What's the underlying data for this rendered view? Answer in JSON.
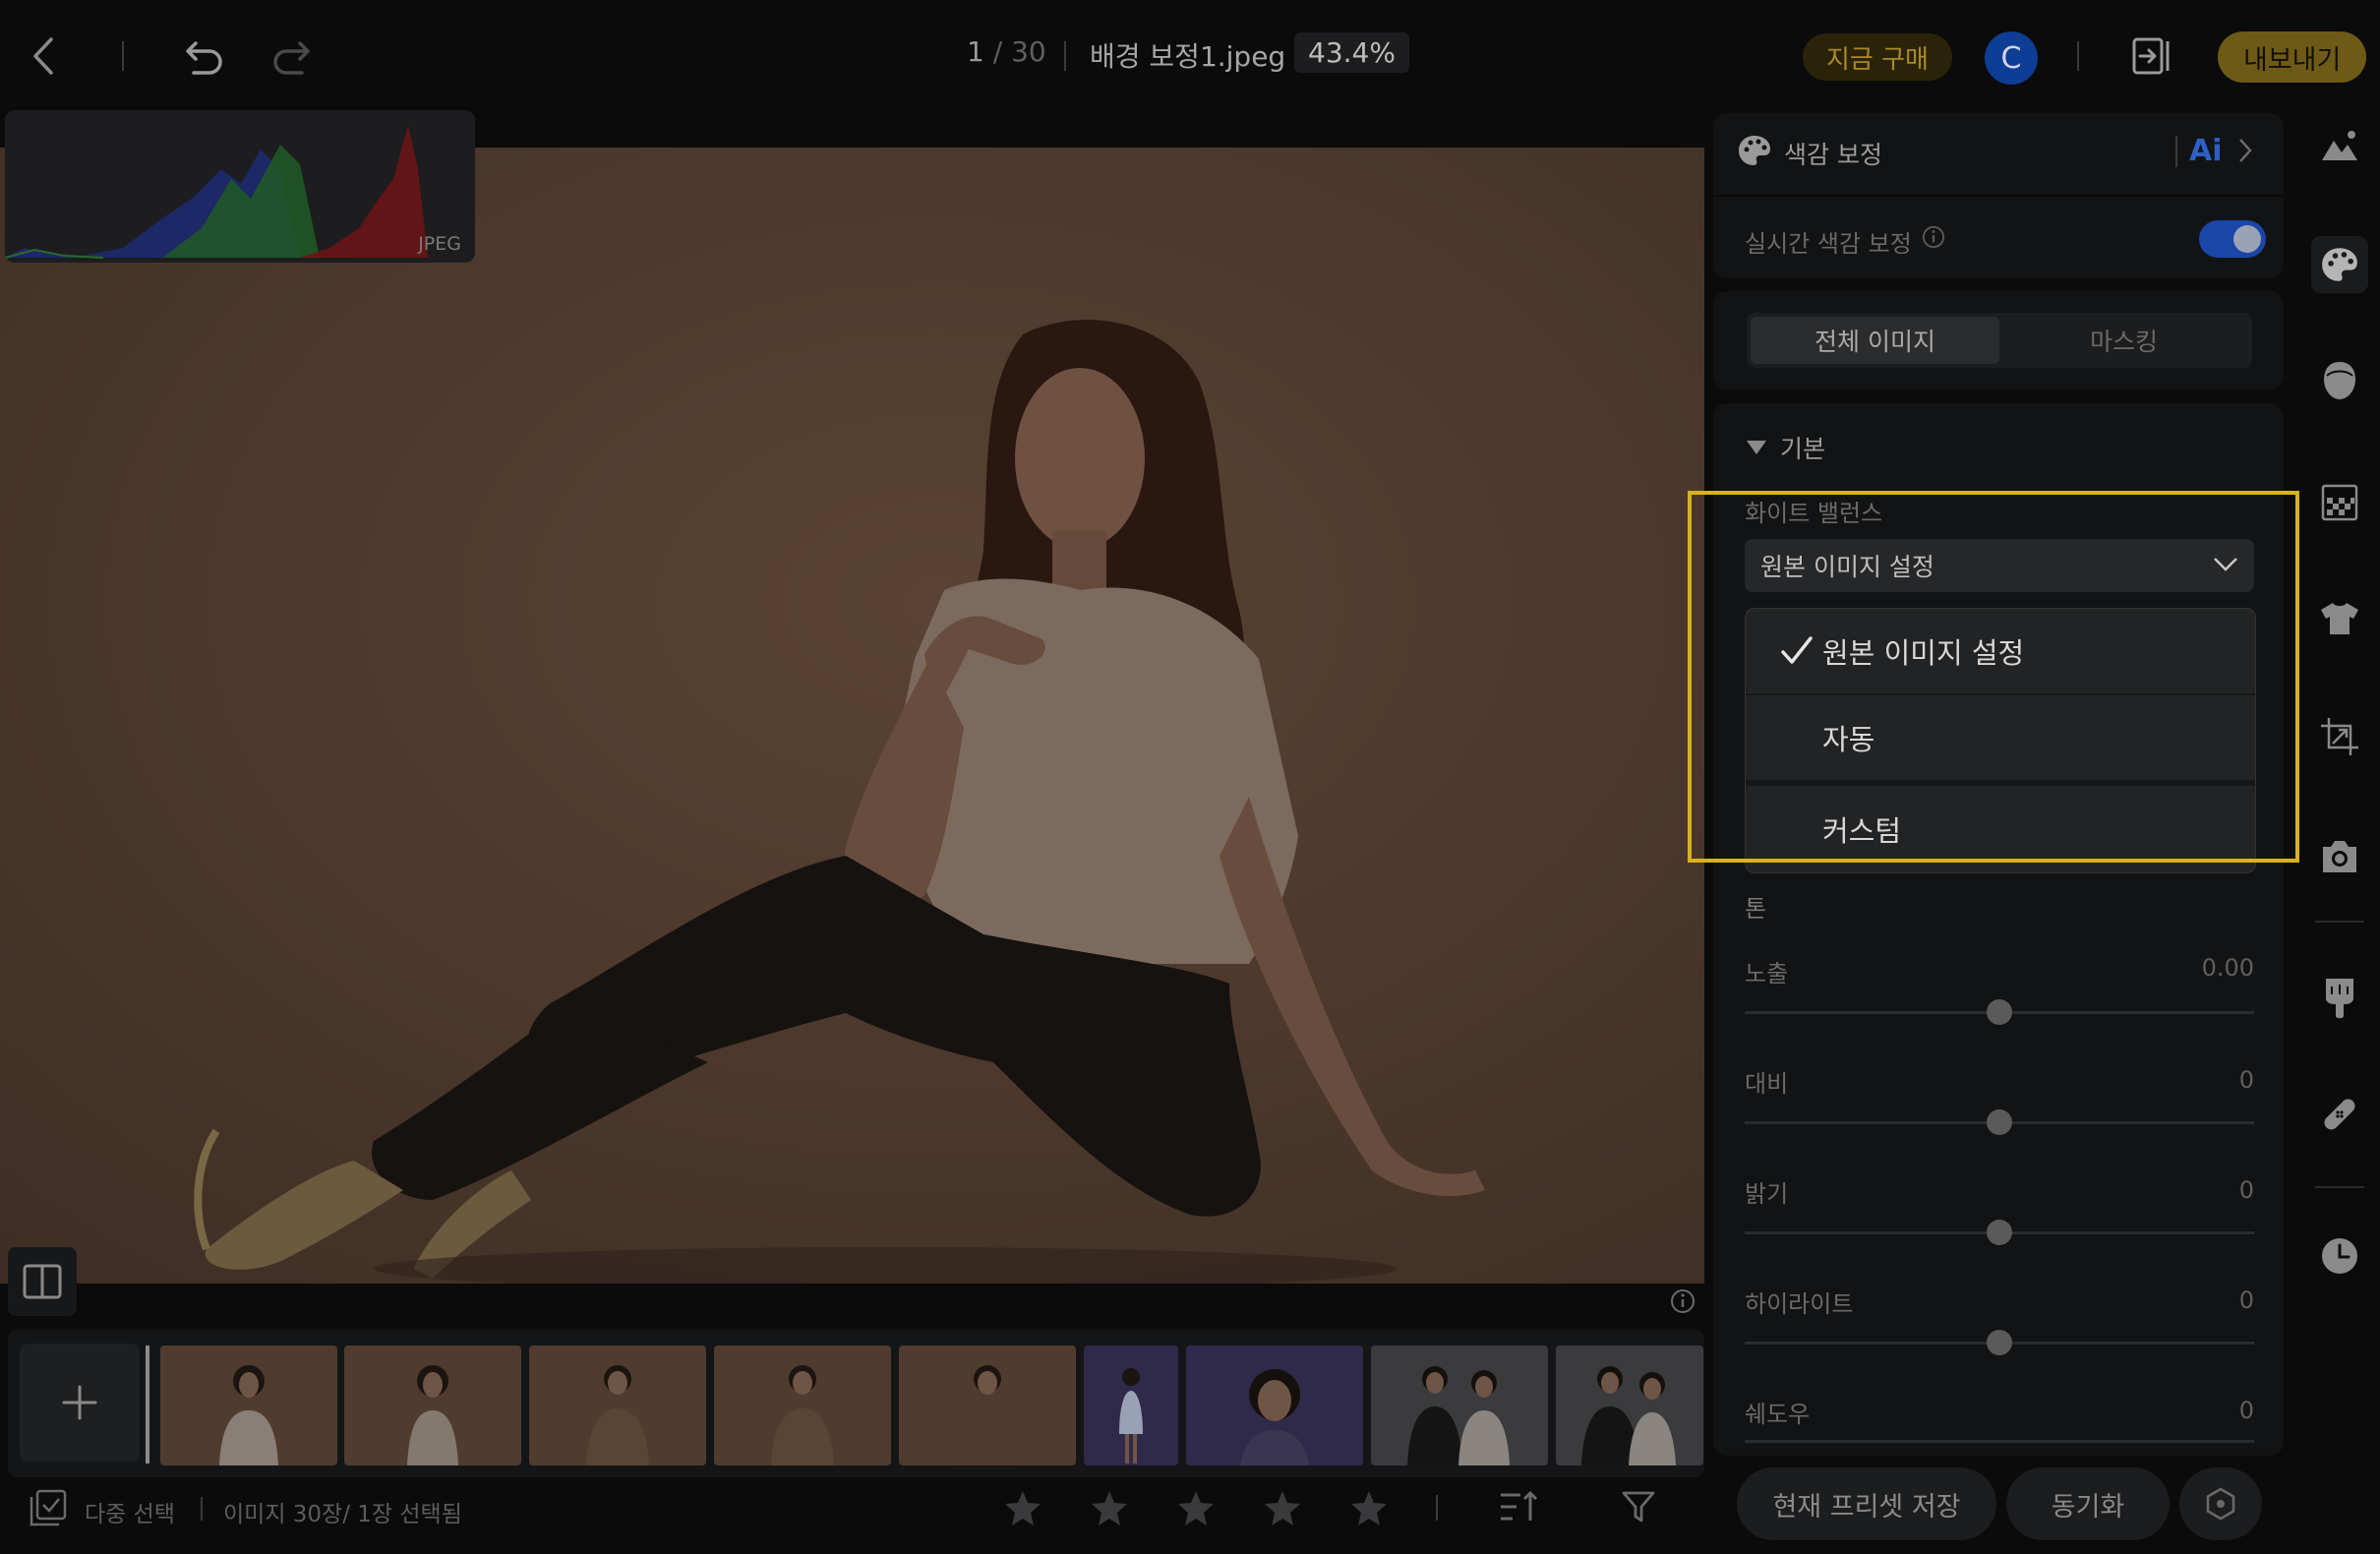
{
  "header": {
    "counter_current": "1",
    "counter_total": "/ 30",
    "filename": "배경 보정1.jpeg",
    "zoom": "43.4%",
    "buy_label": "지금 구매",
    "avatar_initial": "C",
    "export_label": "내보내기"
  },
  "histogram": {
    "format_label": "JPEG"
  },
  "panel": {
    "section_title": "색감 보정",
    "ai_label": "Ai",
    "realtime_label": "실시간 색감 보정",
    "realtime_enabled": true,
    "tabs": [
      {
        "label": "전체 이미지",
        "active": true
      },
      {
        "label": "마스킹",
        "active": false
      }
    ],
    "group_title": "기본",
    "white_balance": {
      "label": "화이트 밸런스",
      "selected": "원본 이미지 설정",
      "options": [
        "원본 이미지 설정",
        "자동",
        "커스텀"
      ]
    },
    "tone_title": "톤",
    "sliders": [
      {
        "label": "노출",
        "value": "0.00"
      },
      {
        "label": "대비",
        "value": "0"
      },
      {
        "label": "밝기",
        "value": "0"
      },
      {
        "label": "하이라이트",
        "value": "0"
      },
      {
        "label": "쉐도우",
        "value": "0"
      }
    ],
    "save_preset_label": "현재 프리셋 저장",
    "sync_label": "동기화"
  },
  "bottom": {
    "multi_select_label": "다중 선택",
    "selection_status": "이미지 30장/ 1장 선택됨"
  },
  "colors": {
    "accent_blue": "#1a46a8",
    "highlight": "#d8b21e",
    "export_bg": "#6e5a17",
    "buy_text": "#a8892a"
  },
  "icons": {
    "back": "chevron-left-icon",
    "undo": "undo-icon",
    "redo": "redo-icon",
    "panel_toggle": "panel-collapse-icon",
    "palette": "palette-icon",
    "compare": "compare-icon",
    "info": "info-icon",
    "add": "plus-icon",
    "sort": "sort-icon",
    "filter": "filter-icon",
    "star": "star-icon"
  }
}
